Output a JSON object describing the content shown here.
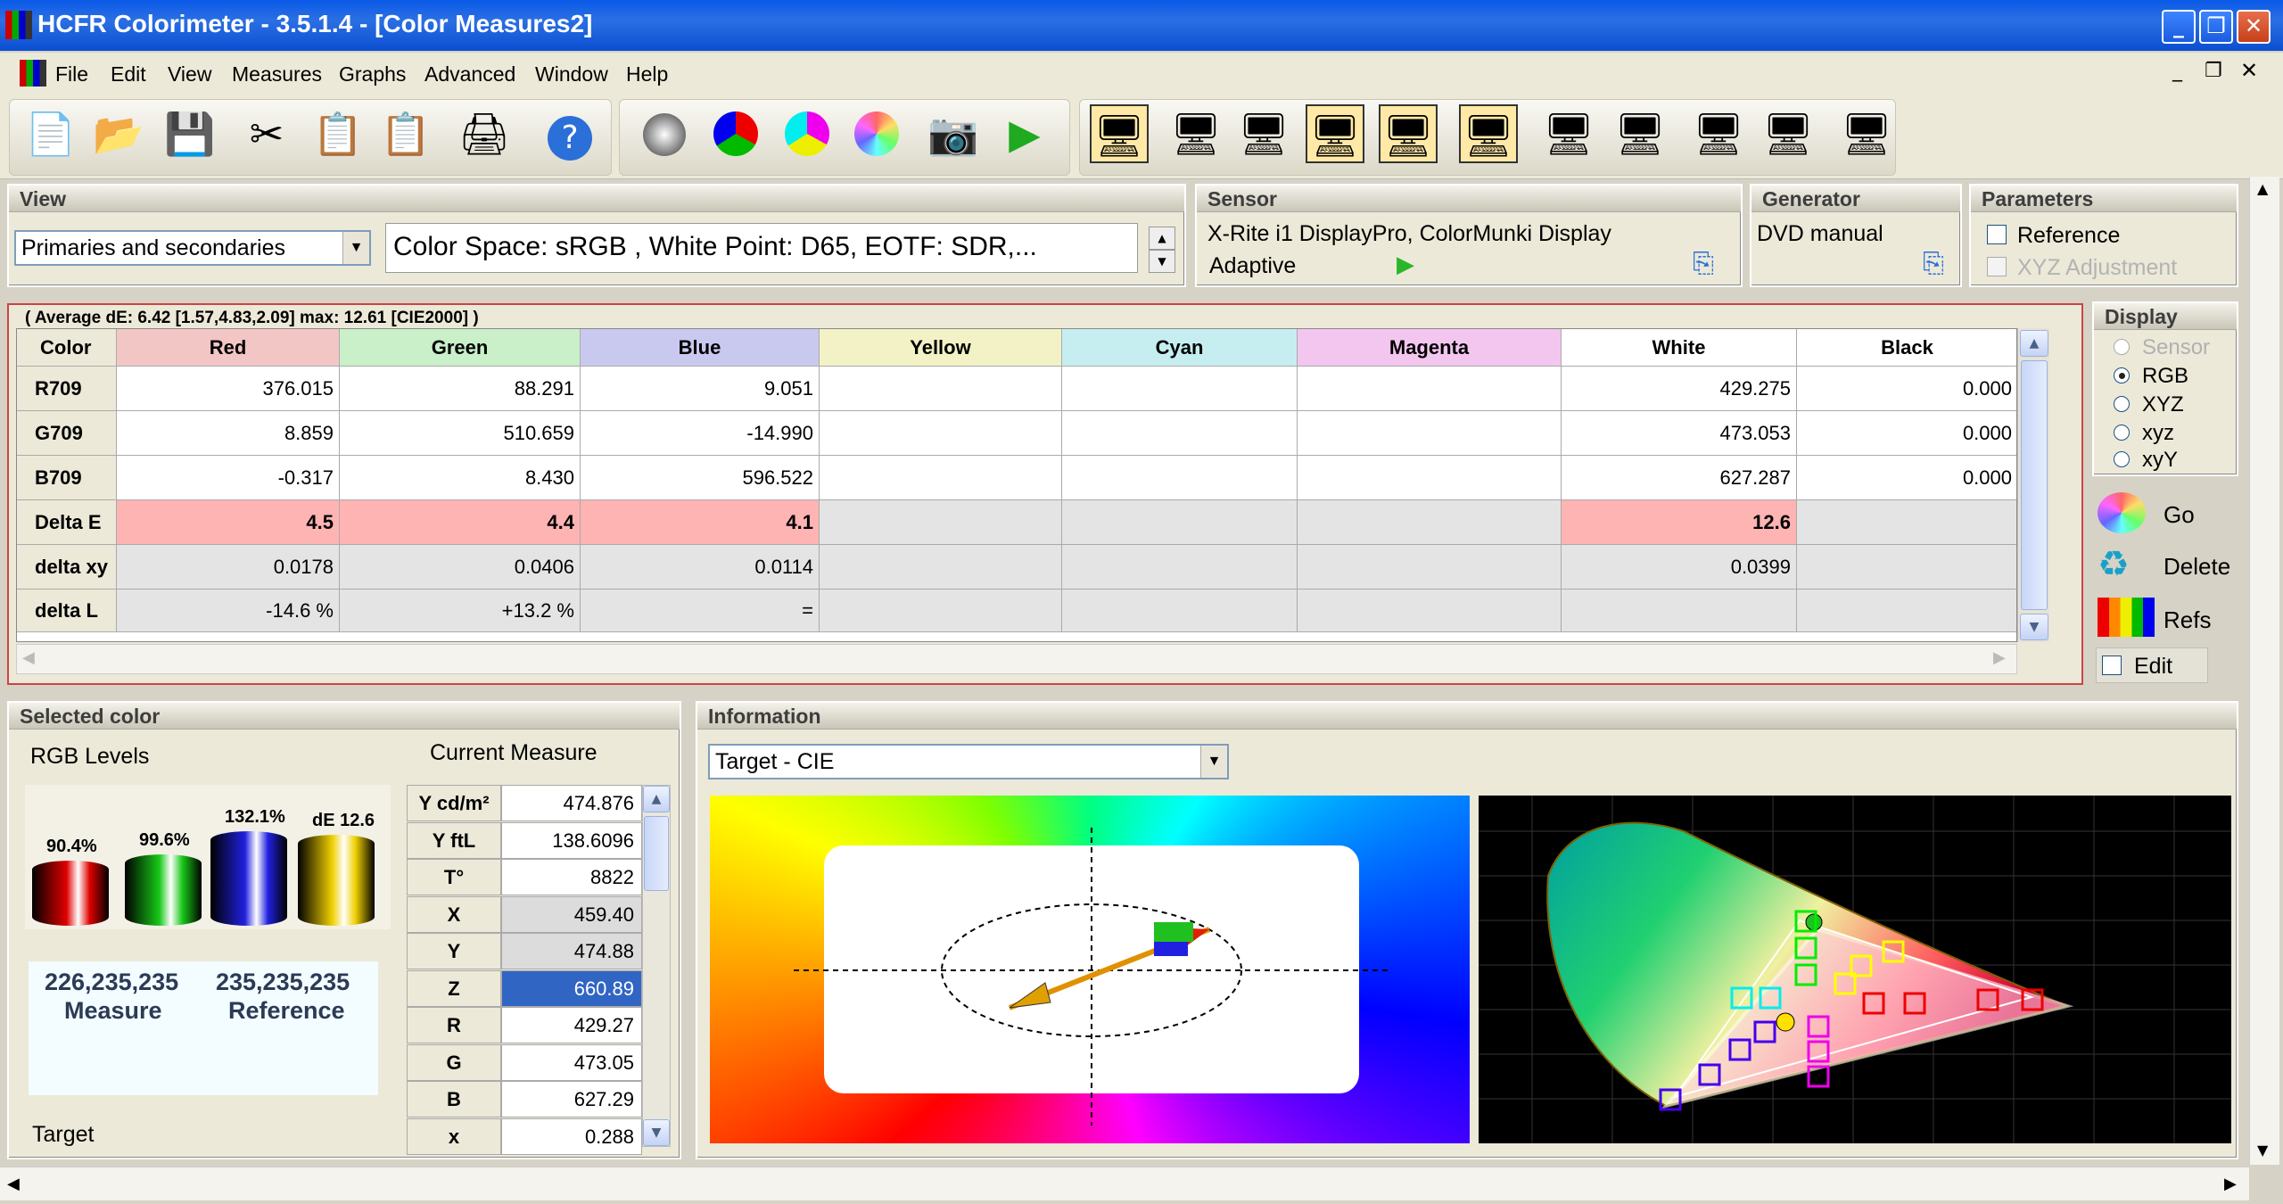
{
  "window": {
    "title": "HCFR Colorimeter - 3.5.1.4 - [Color Measures2]"
  },
  "menu": [
    "File",
    "Edit",
    "View",
    "Measures",
    "Graphs",
    "Advanced",
    "Window",
    "Help"
  ],
  "toolbar": {
    "icons": [
      "new-icon",
      "open-icon",
      "save-icon",
      "cut-icon",
      "copy-icon",
      "paste-icon",
      "print-icon",
      "help-icon",
      "grayscale-measure-icon",
      "primaries-icon",
      "secondaries-icon",
      "saturation-icon",
      "camera-icon",
      "play-icon",
      "measures-view-icon",
      "gamma-graph-icon",
      "luminance-graph-icon",
      "rgb-levels-graph-icon",
      "color-temp-graph-icon",
      "cie-chart-icon",
      "de-graph-icon",
      "near-black-graph-icon",
      "saturation-shift-graph-icon",
      "dE-saturation-graph-icon",
      "free-measures-icon"
    ]
  },
  "view": {
    "header": "View",
    "mode": "Primaries and secondaries",
    "info": "Color Space:  sRGB , White Point:  D65, EOTF:   SDR,..."
  },
  "sensor": {
    "header": "Sensor",
    "name": "X-Rite i1 DisplayPro, ColorMunki Display",
    "mode": "Adaptive"
  },
  "generator": {
    "header": "Generator",
    "name": "DVD manual"
  },
  "parameters": {
    "header": "Parameters",
    "reference": "Reference",
    "xyz_adjustment": "XYZ Adjustment"
  },
  "display": {
    "header": "Display",
    "options": [
      "Sensor",
      "RGB",
      "XYZ",
      "xyz",
      "xyY"
    ],
    "selected": "RGB"
  },
  "actions": {
    "go": "Go",
    "delete": "Delete",
    "refs": "Refs",
    "edit": "Edit"
  },
  "measures": {
    "summary": "( Average dE: 6.42 [1.57,4.83,2.09] max: 12.61 [CIE2000] )",
    "corner": "Color",
    "columns": [
      "Red",
      "Green",
      "Blue",
      "Yellow",
      "Cyan",
      "Magenta",
      "White",
      "Black"
    ],
    "column_colors": [
      "#f3c6c6",
      "#c9f0c9",
      "#c9c9f0",
      "#f2f2c6",
      "#c6eef0",
      "#f3c6f0",
      "#ffffff",
      "#ffffff"
    ],
    "rows": [
      {
        "label": "R709",
        "cells": [
          "376.015",
          "88.291",
          "9.051",
          "",
          "",
          "",
          "429.275",
          "0.000"
        ]
      },
      {
        "label": "G709",
        "cells": [
          "8.859",
          "510.659",
          "-14.990",
          "",
          "",
          "",
          "473.053",
          "0.000"
        ]
      },
      {
        "label": "B709",
        "cells": [
          "-0.317",
          "8.430",
          "596.522",
          "",
          "",
          "",
          "627.287",
          "0.000"
        ]
      },
      {
        "label": "Delta E",
        "cells": [
          "4.5",
          "4.4",
          "4.1",
          "",
          "",
          "",
          "12.6",
          ""
        ]
      },
      {
        "label": "delta xy",
        "cells": [
          "0.0178",
          "0.0406",
          "0.0114",
          "",
          "",
          "",
          "0.0399",
          ""
        ]
      },
      {
        "label": "delta L",
        "cells": [
          "-14.6 %",
          "+13.2 %",
          "=",
          "",
          "",
          "",
          "",
          ""
        ]
      }
    ]
  },
  "selected_color": {
    "header": "Selected color",
    "rgb_levels": "RGB Levels",
    "current_measure": "Current Measure",
    "bars": [
      {
        "label": "90.4%",
        "value": 90.4,
        "color": "#e00000"
      },
      {
        "label": "99.6%",
        "value": 99.6,
        "color": "#18c818"
      },
      {
        "label": "132.1%",
        "value": 132.1,
        "color": "#2020e0"
      },
      {
        "label": "dE 12.6",
        "value": 12.6,
        "color": "#f0d000"
      }
    ],
    "measure_value": "226,235,235",
    "measure_label": "Measure",
    "reference_value": "235,235,235",
    "reference_label": "Reference",
    "target": "Target",
    "measure_table": [
      {
        "k": "Y cd/m²",
        "v": "474.876"
      },
      {
        "k": "Y ftL",
        "v": "138.6096"
      },
      {
        "k": "T°",
        "v": "8822"
      },
      {
        "k": "X",
        "v": "459.40"
      },
      {
        "k": "Y",
        "v": "474.88"
      },
      {
        "k": "Z",
        "v": "660.89"
      },
      {
        "k": "R",
        "v": "429.27"
      },
      {
        "k": "G",
        "v": "473.05"
      },
      {
        "k": "B",
        "v": "627.29"
      },
      {
        "k": "x",
        "v": "0.288"
      }
    ]
  },
  "information": {
    "header": "Information",
    "mode": "Target - CIE"
  }
}
